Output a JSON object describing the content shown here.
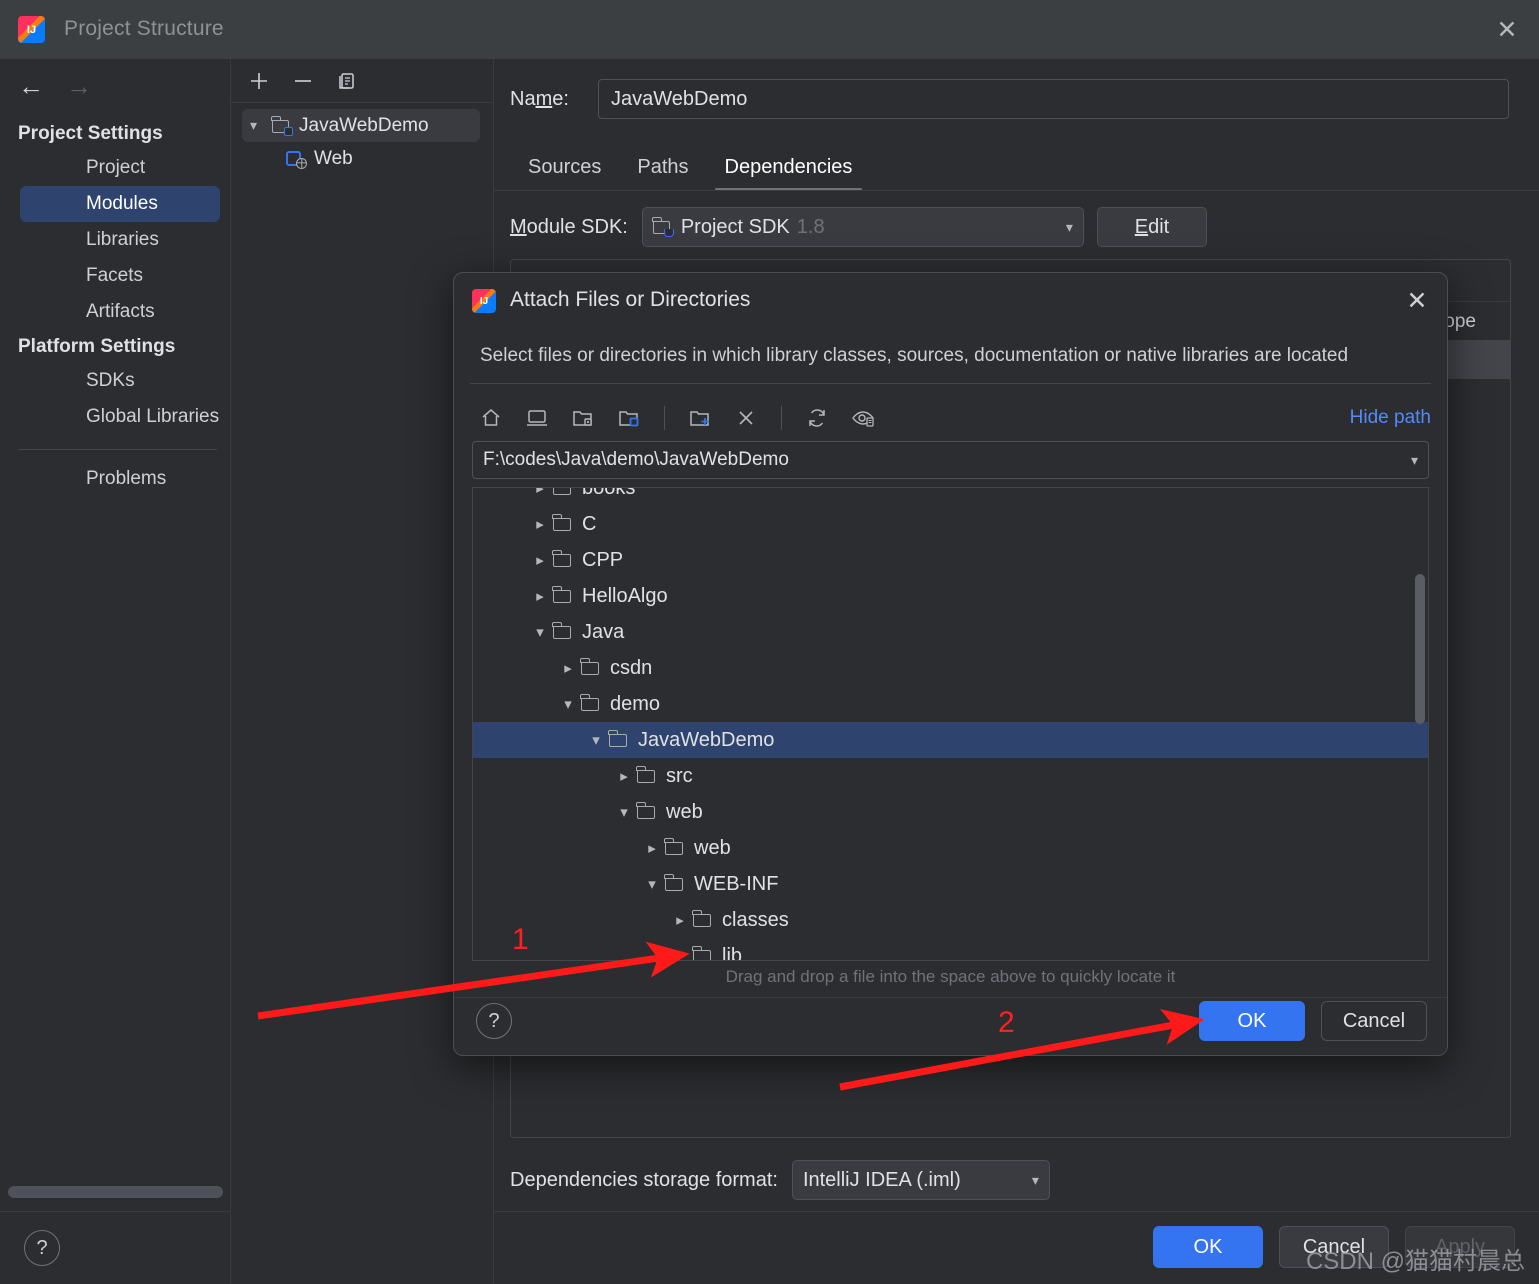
{
  "window": {
    "title": "Project Structure",
    "close_icon": "close-icon",
    "logo_icon": "intellij-logo-icon"
  },
  "sidebar": {
    "back_icon": "arrow-left-icon",
    "forward_icon": "arrow-right-icon",
    "groups": [
      {
        "title": "Project Settings",
        "items": [
          {
            "label": "Project",
            "selected": false
          },
          {
            "label": "Modules",
            "selected": true
          },
          {
            "label": "Libraries",
            "selected": false
          },
          {
            "label": "Facets",
            "selected": false
          },
          {
            "label": "Artifacts",
            "selected": false
          }
        ]
      },
      {
        "title": "Platform Settings",
        "items": [
          {
            "label": "SDKs",
            "selected": false
          },
          {
            "label": "Global Libraries",
            "selected": false
          }
        ]
      }
    ],
    "problems_label": "Problems",
    "help_label": "?"
  },
  "modules_panel": {
    "toolbar": {
      "add_icon": "plus-icon",
      "remove_icon": "minus-icon",
      "copy_icon": "copy-icon"
    },
    "tree": [
      {
        "label": "JavaWebDemo",
        "icon": "module-folder-icon",
        "selected": true,
        "expanded": true,
        "depth": 0
      },
      {
        "label": "Web",
        "icon": "web-facet-icon",
        "selected": false,
        "expanded": null,
        "depth": 1
      }
    ]
  },
  "main": {
    "name_label": "Name:",
    "name_value": "JavaWebDemo",
    "name_placeholder": "",
    "tabs": [
      {
        "label": "Sources",
        "active": false
      },
      {
        "label": "Paths",
        "active": false
      },
      {
        "label": "Dependencies",
        "active": true
      }
    ],
    "module_sdk_label": "Module SDK:",
    "module_sdk_value": "Project SDK",
    "module_sdk_version": "1.8",
    "edit_button": "Edit",
    "dep_toolbar": {
      "add_icon": "plus-icon",
      "remove_icon": "minus-icon",
      "move_up_icon": "arrow-up-icon",
      "move_down_icon": "arrow-down-icon",
      "edit_icon": "pencil-icon"
    },
    "dep_columns": [
      "Scope"
    ],
    "scope_partial_label": "ope",
    "storage_label": "Dependencies storage format:",
    "storage_value": "IntelliJ IDEA (.iml)",
    "buttons": {
      "ok": "OK",
      "cancel": "Cancel",
      "apply": "Apply"
    }
  },
  "dialog": {
    "title": "Attach Files or Directories",
    "logo_icon": "intellij-logo-icon",
    "close_icon": "close-icon",
    "description": "Select files or directories in which library classes, sources, documentation or native libraries are located",
    "toolbar": [
      {
        "name": "home-icon",
        "glyph": "home"
      },
      {
        "name": "desktop-icon",
        "glyph": "desktop"
      },
      {
        "name": "project-folder-icon",
        "glyph": "project"
      },
      {
        "name": "module-folder-icon",
        "glyph": "module"
      },
      {
        "name": "new-folder-icon",
        "glyph": "newfolder"
      },
      {
        "name": "delete-icon",
        "glyph": "x"
      },
      {
        "name": "refresh-icon",
        "glyph": "refresh"
      },
      {
        "name": "show-hidden-files-icon",
        "glyph": "hidden"
      }
    ],
    "hide_path_label": "Hide path",
    "path_value": "F:\\codes\\Java\\demo\\JavaWebDemo",
    "path_placeholder": "",
    "tree": [
      {
        "label": "books",
        "depth": 1,
        "chevron": "right",
        "selected": false,
        "clipped": true
      },
      {
        "label": "C",
        "depth": 1,
        "chevron": "right",
        "selected": false
      },
      {
        "label": "CPP",
        "depth": 1,
        "chevron": "right",
        "selected": false
      },
      {
        "label": "HelloAlgo",
        "depth": 1,
        "chevron": "right",
        "selected": false
      },
      {
        "label": "Java",
        "depth": 1,
        "chevron": "down",
        "selected": false
      },
      {
        "label": "csdn",
        "depth": 2,
        "chevron": "right",
        "selected": false
      },
      {
        "label": "demo",
        "depth": 2,
        "chevron": "down",
        "selected": false
      },
      {
        "label": "JavaWebDemo",
        "depth": 3,
        "chevron": "down",
        "selected": true
      },
      {
        "label": "src",
        "depth": 4,
        "chevron": "right",
        "selected": false
      },
      {
        "label": "web",
        "depth": 4,
        "chevron": "down",
        "selected": false
      },
      {
        "label": "web",
        "depth": 5,
        "chevron": "right",
        "selected": false
      },
      {
        "label": "WEB-INF",
        "depth": 5,
        "chevron": "down",
        "selected": false
      },
      {
        "label": "classes",
        "depth": 6,
        "chevron": "right",
        "selected": false
      },
      {
        "label": "lib",
        "depth": 6,
        "chevron": "right",
        "selected": false
      }
    ],
    "hint": "Drag and drop a file into the space above to quickly locate it",
    "help_label": "?",
    "buttons": {
      "ok": "OK",
      "cancel": "Cancel"
    }
  },
  "annotations": {
    "marker_color": "#ff2020",
    "items": [
      {
        "number": "1",
        "target": "lib-folder-expand-chevron"
      },
      {
        "number": "2",
        "target": "dialog-ok-button"
      }
    ]
  },
  "watermark": {
    "text": "CSDN @猫猫村晨总"
  }
}
